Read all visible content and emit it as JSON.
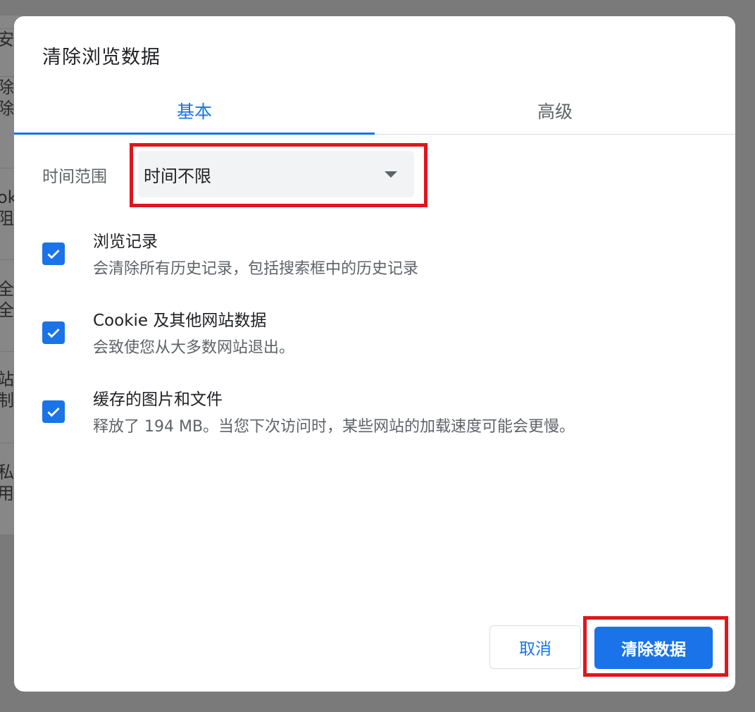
{
  "dialog": {
    "title": "清除浏览数据",
    "tabs": [
      {
        "label": "基本",
        "selected": true
      },
      {
        "label": "高级",
        "selected": false
      }
    ],
    "time_range": {
      "label": "时间范围",
      "selected_value": "时间不限"
    },
    "options": [
      {
        "title": "浏览记录",
        "description": "会清除所有历史记录，包括搜索框中的历史记录",
        "checked": true
      },
      {
        "title": "Cookie 及其他网站数据",
        "description": "会致使您从大多数网站退出。",
        "checked": true
      },
      {
        "title": "缓存的图片和文件",
        "description": "释放了 194 MB。当您下次访问时，某些网站的加载速度可能会更慢。",
        "checked": true
      }
    ],
    "buttons": {
      "cancel": "取消",
      "clear": "清除数据"
    }
  },
  "background_fragments": [
    "安",
    "除",
    "除",
    "ok",
    "阻",
    "全",
    "全",
    "站",
    "制",
    "私",
    "用"
  ],
  "colors": {
    "accent": "#1a73e8",
    "highlight": "#e0161c",
    "overlay": "#5f5f5f"
  }
}
